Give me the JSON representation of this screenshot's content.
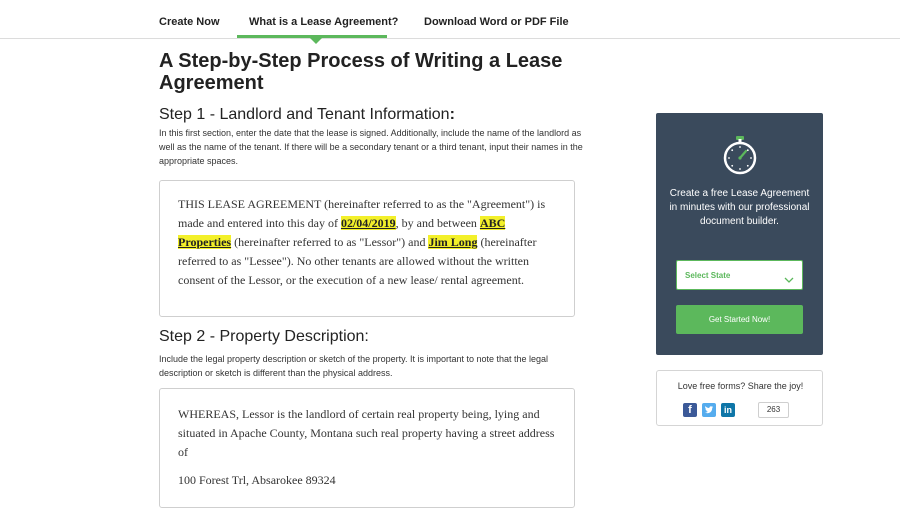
{
  "nav": {
    "tabs": [
      {
        "label": "Create Now"
      },
      {
        "label": "What is a Lease Agreement?"
      },
      {
        "label": "Download Word or PDF File"
      }
    ],
    "active_tab": "What is a Lease Agreement?"
  },
  "main": {
    "title": "A Step-by-Step Process of Writing a Lease Agreement",
    "step1": {
      "heading": "Step 1 - Landlord and Tenant Information",
      "heading_colon": ":",
      "description": "In this first section, enter the date that the lease is signed. Additionally, include the name of the landlord as well as the name of the tenant. If there will be a secondary tenant or a third tenant, input their names in the appropriate spaces.",
      "doc": {
        "t1": "THIS LEASE AGREEMENT (hereinafter referred to as the \"Agreement\") is made and entered into this day of ",
        "date": "02/04/2019",
        "t2": ", by and between ",
        "lessor": "ABC Properties",
        "t3": " (hereinafter referred to as \"Lessor\") and ",
        "lessee": "Jim Long",
        "t4": " (hereinafter referred to as \"Lessee\").  No other tenants are allowed without the written consent of the Lessor, or the execution of a new lease/ rental agreement."
      }
    },
    "step2": {
      "heading": "Step 2 - Property Description:",
      "description": "Include the legal property description or sketch of the property. It is important to note that the legal description or sketch is different than the physical address.",
      "doc": {
        "text": "WHEREAS, Lessor is the landlord of certain real property being, lying and situated in Apache County, Montana such real property having a street address of",
        "address": "100 Forest Trl, Absarokee 89324"
      }
    }
  },
  "promo": {
    "text": "Create a free Lease Agreement in minutes with our professional document builder.",
    "select_label": "Select State",
    "button_label": "Get Started Now!",
    "bg_color": "#3a4a5c",
    "accent_color": "#5cb85c"
  },
  "share": {
    "text": "Love free forms? Share the joy!",
    "count": "263",
    "icons": [
      "facebook-icon",
      "twitter-icon",
      "linkedin-icon"
    ]
  },
  "highlight_color": "#f3f02a"
}
